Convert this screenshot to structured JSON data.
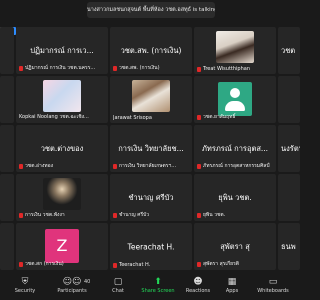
{
  "banner": {
    "speaking_text": "นางสาวกมลชนกสุจนต์ พื้นที่ห้อง วชต.อสทุธ์ is talking..."
  },
  "tiles": [
    {
      "center": "",
      "label": ""
    },
    {
      "center": "ปฏิมากรณ์ การเว...",
      "label": "ปฏิมากรณ์ การเงิน วชต.นครร..."
    },
    {
      "center": "วชต.สพ. (การเงิน)",
      "label": "วชต.สพ. (การเงิน)"
    },
    {
      "center": "",
      "label": "Treat Wisutthiphan"
    },
    {
      "center": "วชต",
      "label": ""
    },
    {
      "center": "",
      "label": ""
    },
    {
      "center": "",
      "label": "Kopkai Noolang วชต.ฉะเชิง..."
    },
    {
      "center": "",
      "label": "Jarawat Srisopa"
    },
    {
      "center": "",
      "label": "วชต.ยาสัมฤทธิ์"
    },
    {
      "center": "",
      "label": ""
    },
    {
      "center": "",
      "label": ""
    },
    {
      "center": "วชต.ต่างของ",
      "label": "วชต.อ่างทอง"
    },
    {
      "center": "การเงิน วิทยาลัยช...",
      "label": "การเงิน วิทยาลัยเกษตรฯ..."
    },
    {
      "center": "ภัทรภรณ์ การอุตส...",
      "label": "ภัทรภรณ์ การอุตสาหกรรมศิลป์"
    },
    {
      "center": "นงรัตน",
      "label": ""
    },
    {
      "center": "",
      "label": ""
    },
    {
      "center": "",
      "label": "การเงิน วชต.พังงา"
    },
    {
      "center": "ชำนาญ ศรีบัว",
      "label": "ชำนาญ ศรีบัว"
    },
    {
      "center": "ยุพิน วชต.",
      "label": "ยุพิน วชต."
    },
    {
      "center": "",
      "label": ""
    },
    {
      "center": "",
      "label": ""
    },
    {
      "center": "",
      "label": "วชต.สก (การเงิน)"
    },
    {
      "center": "Teerachat H.",
      "label": "Teerachat H."
    },
    {
      "center": "สุพัตรา สุ",
      "label": "สุพัตรา สุรเกียรติ"
    },
    {
      "center": "ธนพ",
      "label": ""
    }
  ],
  "avatars": {
    "z_letter": "Z"
  },
  "toolbar": {
    "security": "Security",
    "participants": "Participants",
    "participants_count": "40",
    "chat": "Chat",
    "share": "Share Screen",
    "reactions": "Reactions",
    "apps": "Apps",
    "whiteboards": "Whiteboards"
  },
  "colors": {
    "share_green": "#23d959",
    "mute_red": "#e02828",
    "tile_bg": "#262626",
    "accent_blue": "#2d8cff"
  }
}
